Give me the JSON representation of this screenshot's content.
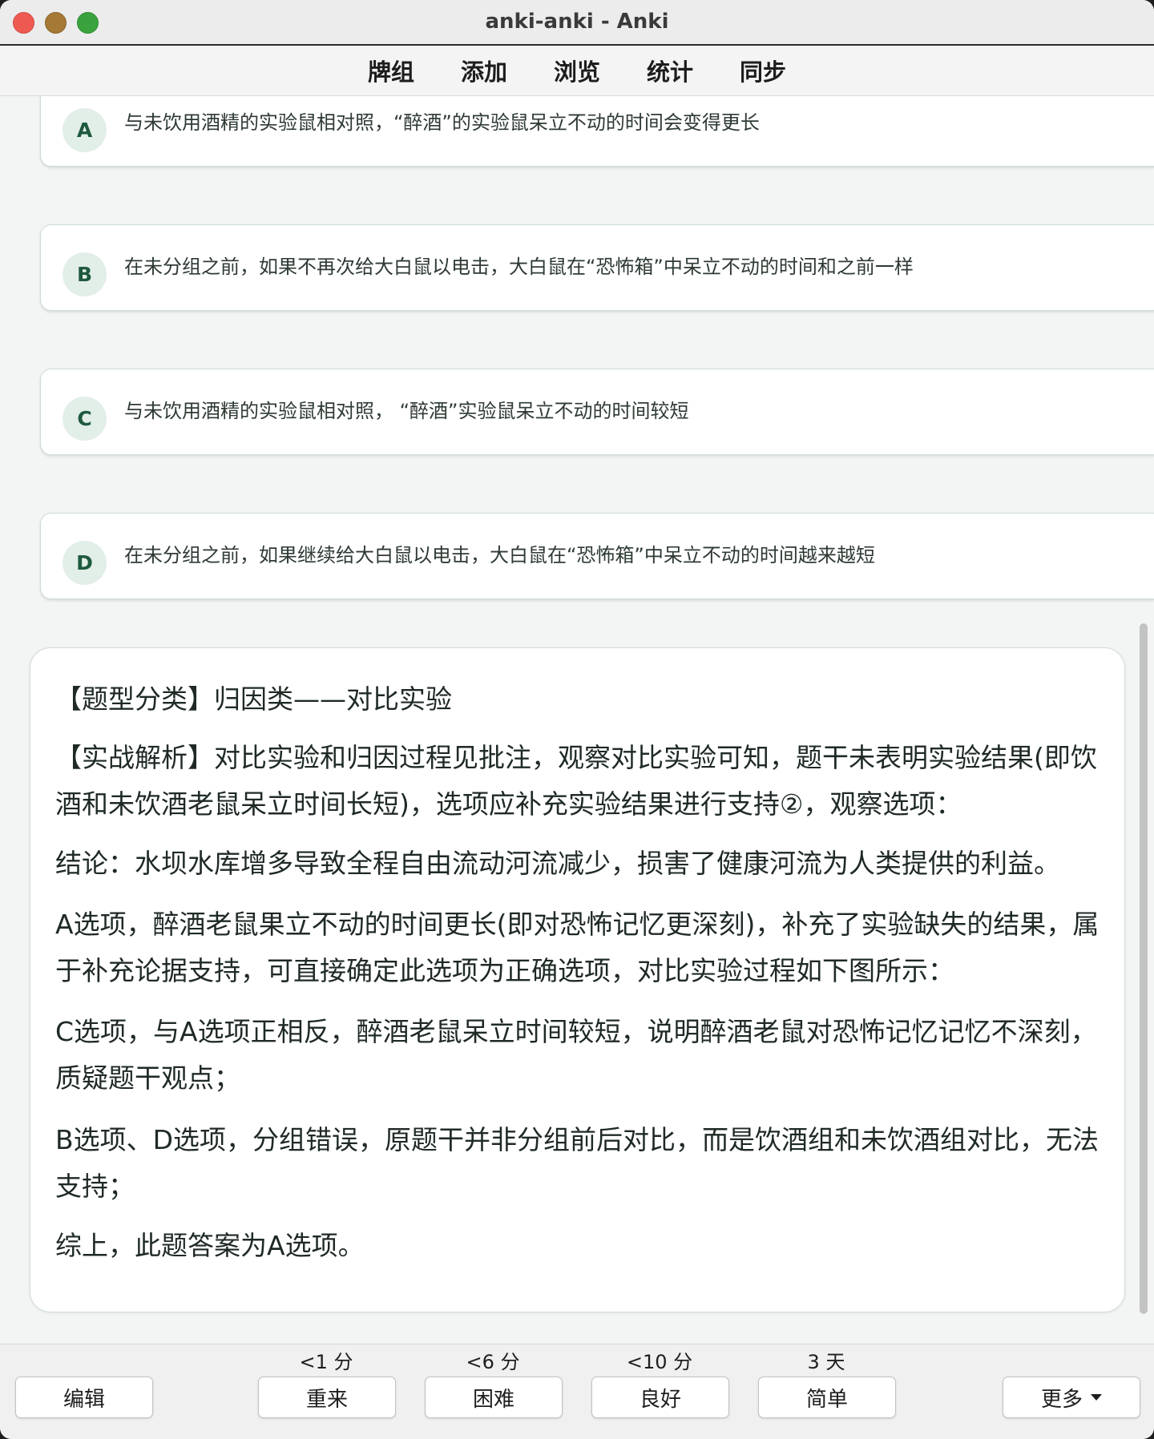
{
  "window": {
    "title": "anki-anki - Anki"
  },
  "topnav": {
    "items": [
      "牌组",
      "添加",
      "浏览",
      "统计",
      "同步"
    ]
  },
  "options": [
    {
      "letter": "A",
      "text": "与未饮用酒精的实验鼠相对照，“醉酒”的实验鼠呆立不动的时间会变得更长"
    },
    {
      "letter": "B",
      "text": "在未分组之前，如果不再次给大白鼠以电击，大白鼠在“恐怖箱”中呆立不动的时间和之前一样"
    },
    {
      "letter": "C",
      "text": "与未饮用酒精的实验鼠相对照，  “醉酒”实验鼠呆立不动的时间较短"
    },
    {
      "letter": "D",
      "text": "在未分组之前，如果继续给大白鼠以电击，大白鼠在“恐怖箱”中呆立不动的时间越来越短"
    }
  ],
  "analysis": {
    "paragraphs": [
      "【题型分类】归因类——对比实验",
      "【实战解析】对比实验和归因过程见批注，观察对比实验可知，题干未表明实验结果(即饮酒和未饮酒老鼠呆立时间长短)，选项应补充实验结果进行支持②，观察选项：",
      "结论：水坝水库增多导致全程自由流动河流减少，损害了健康河流为人类提供的利益。",
      "A选项，醉酒老鼠果立不动的时间更长(即对恐怖记忆更深刻)，补充了实验缺失的结果，属于补充论据支持，可直接确定此选项为正确选项，对比实验过程如下图所示：",
      "C选项，与A选项正相反，醉酒老鼠呆立时间较短，说明醉酒老鼠对恐怖记忆记忆不深刻，质疑题干观点；",
      "B选项、D选项，分组错误，原题干并非分组前后对比，而是饮酒组和未饮酒组对比，无法支持；",
      "综上，此题答案为A选项。"
    ]
  },
  "bottombar": {
    "edit_label": "编辑",
    "more_label": "更多",
    "answers": [
      {
        "label": "重来",
        "interval": "<1 分"
      },
      {
        "label": "困难",
        "interval": "<6 分"
      },
      {
        "label": "良好",
        "interval": "<10 分"
      },
      {
        "label": "简单",
        "interval": "3 天"
      }
    ]
  }
}
